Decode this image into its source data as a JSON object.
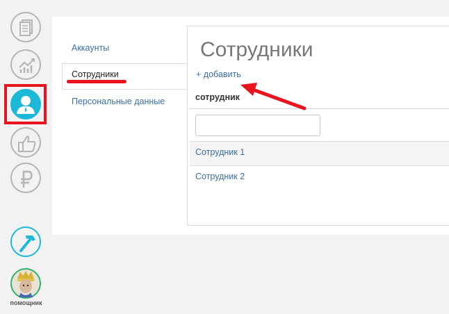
{
  "sidebar": {
    "items": [
      {
        "icon": "documents-icon",
        "active": false
      },
      {
        "icon": "chart-growth-icon",
        "active": false
      },
      {
        "icon": "user-icon",
        "active": true
      },
      {
        "icon": "thumbs-up-icon",
        "active": false
      },
      {
        "icon": "ruble-icon",
        "active": false
      },
      {
        "icon": "hammer-icon",
        "active": false
      }
    ],
    "helper_label": "помощник"
  },
  "subnav": {
    "items": [
      {
        "label": "Аккаунты"
      },
      {
        "label": "Сотрудники",
        "active": true
      },
      {
        "label": "Персональные данные"
      }
    ]
  },
  "main": {
    "title": "Сотрудники",
    "add_label": "+ добавить",
    "table": {
      "column_header": "сотрудник",
      "filter_value": "",
      "rows": [
        "Сотрудник 1",
        "Сотрудник 2"
      ]
    }
  },
  "colors": {
    "accent": "#1cb8d8",
    "highlight": "#e8141d",
    "link": "#3a6fa8"
  }
}
